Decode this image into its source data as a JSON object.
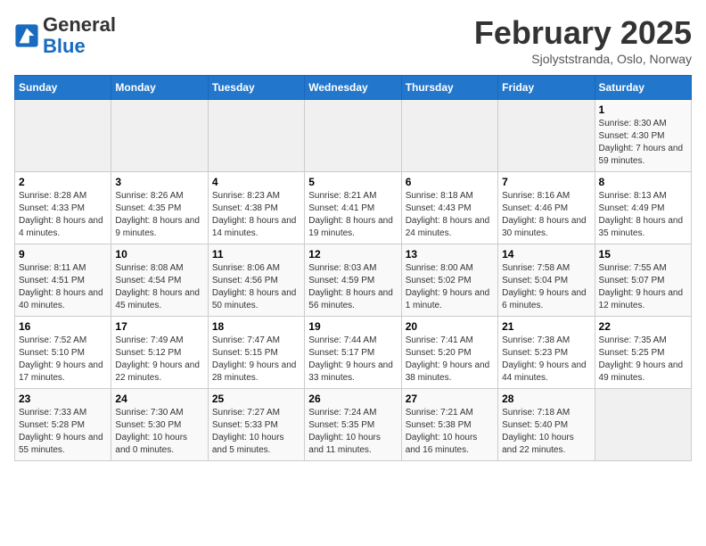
{
  "header": {
    "logo_general": "General",
    "logo_blue": "Blue",
    "month_title": "February 2025",
    "subtitle": "Sjolyststranda, Oslo, Norway"
  },
  "days_of_week": [
    "Sunday",
    "Monday",
    "Tuesday",
    "Wednesday",
    "Thursday",
    "Friday",
    "Saturday"
  ],
  "weeks": [
    [
      {
        "day": "",
        "info": ""
      },
      {
        "day": "",
        "info": ""
      },
      {
        "day": "",
        "info": ""
      },
      {
        "day": "",
        "info": ""
      },
      {
        "day": "",
        "info": ""
      },
      {
        "day": "",
        "info": ""
      },
      {
        "day": "1",
        "info": "Sunrise: 8:30 AM\nSunset: 4:30 PM\nDaylight: 7 hours and 59 minutes."
      }
    ],
    [
      {
        "day": "2",
        "info": "Sunrise: 8:28 AM\nSunset: 4:33 PM\nDaylight: 8 hours and 4 minutes."
      },
      {
        "day": "3",
        "info": "Sunrise: 8:26 AM\nSunset: 4:35 PM\nDaylight: 8 hours and 9 minutes."
      },
      {
        "day": "4",
        "info": "Sunrise: 8:23 AM\nSunset: 4:38 PM\nDaylight: 8 hours and 14 minutes."
      },
      {
        "day": "5",
        "info": "Sunrise: 8:21 AM\nSunset: 4:41 PM\nDaylight: 8 hours and 19 minutes."
      },
      {
        "day": "6",
        "info": "Sunrise: 8:18 AM\nSunset: 4:43 PM\nDaylight: 8 hours and 24 minutes."
      },
      {
        "day": "7",
        "info": "Sunrise: 8:16 AM\nSunset: 4:46 PM\nDaylight: 8 hours and 30 minutes."
      },
      {
        "day": "8",
        "info": "Sunrise: 8:13 AM\nSunset: 4:49 PM\nDaylight: 8 hours and 35 minutes."
      }
    ],
    [
      {
        "day": "9",
        "info": "Sunrise: 8:11 AM\nSunset: 4:51 PM\nDaylight: 8 hours and 40 minutes."
      },
      {
        "day": "10",
        "info": "Sunrise: 8:08 AM\nSunset: 4:54 PM\nDaylight: 8 hours and 45 minutes."
      },
      {
        "day": "11",
        "info": "Sunrise: 8:06 AM\nSunset: 4:56 PM\nDaylight: 8 hours and 50 minutes."
      },
      {
        "day": "12",
        "info": "Sunrise: 8:03 AM\nSunset: 4:59 PM\nDaylight: 8 hours and 56 minutes."
      },
      {
        "day": "13",
        "info": "Sunrise: 8:00 AM\nSunset: 5:02 PM\nDaylight: 9 hours and 1 minute."
      },
      {
        "day": "14",
        "info": "Sunrise: 7:58 AM\nSunset: 5:04 PM\nDaylight: 9 hours and 6 minutes."
      },
      {
        "day": "15",
        "info": "Sunrise: 7:55 AM\nSunset: 5:07 PM\nDaylight: 9 hours and 12 minutes."
      }
    ],
    [
      {
        "day": "16",
        "info": "Sunrise: 7:52 AM\nSunset: 5:10 PM\nDaylight: 9 hours and 17 minutes."
      },
      {
        "day": "17",
        "info": "Sunrise: 7:49 AM\nSunset: 5:12 PM\nDaylight: 9 hours and 22 minutes."
      },
      {
        "day": "18",
        "info": "Sunrise: 7:47 AM\nSunset: 5:15 PM\nDaylight: 9 hours and 28 minutes."
      },
      {
        "day": "19",
        "info": "Sunrise: 7:44 AM\nSunset: 5:17 PM\nDaylight: 9 hours and 33 minutes."
      },
      {
        "day": "20",
        "info": "Sunrise: 7:41 AM\nSunset: 5:20 PM\nDaylight: 9 hours and 38 minutes."
      },
      {
        "day": "21",
        "info": "Sunrise: 7:38 AM\nSunset: 5:23 PM\nDaylight: 9 hours and 44 minutes."
      },
      {
        "day": "22",
        "info": "Sunrise: 7:35 AM\nSunset: 5:25 PM\nDaylight: 9 hours and 49 minutes."
      }
    ],
    [
      {
        "day": "23",
        "info": "Sunrise: 7:33 AM\nSunset: 5:28 PM\nDaylight: 9 hours and 55 minutes."
      },
      {
        "day": "24",
        "info": "Sunrise: 7:30 AM\nSunset: 5:30 PM\nDaylight: 10 hours and 0 minutes."
      },
      {
        "day": "25",
        "info": "Sunrise: 7:27 AM\nSunset: 5:33 PM\nDaylight: 10 hours and 5 minutes."
      },
      {
        "day": "26",
        "info": "Sunrise: 7:24 AM\nSunset: 5:35 PM\nDaylight: 10 hours and 11 minutes."
      },
      {
        "day": "27",
        "info": "Sunrise: 7:21 AM\nSunset: 5:38 PM\nDaylight: 10 hours and 16 minutes."
      },
      {
        "day": "28",
        "info": "Sunrise: 7:18 AM\nSunset: 5:40 PM\nDaylight: 10 hours and 22 minutes."
      },
      {
        "day": "",
        "info": ""
      }
    ]
  ]
}
